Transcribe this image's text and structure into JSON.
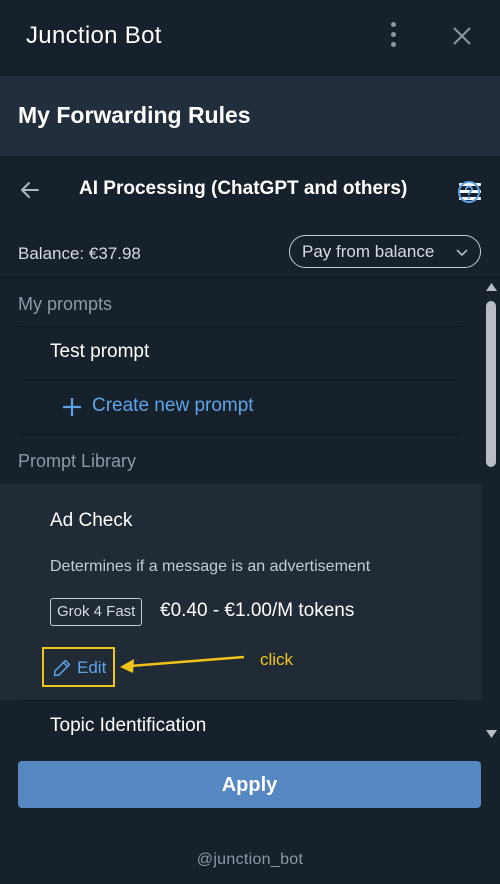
{
  "window": {
    "title": "Junction Bot",
    "menu_icon": "more-vertical-icon",
    "close_icon": "close-icon"
  },
  "header": {
    "title": "My Forwarding Rules",
    "menu_icon": "hamburger-icon"
  },
  "subheader": {
    "back_icon": "arrow-left-icon",
    "title": "AI Processing (ChatGPT and others)",
    "help_icon": "help-circle-icon"
  },
  "balance": {
    "text": "Balance: €37.98",
    "payment_select": {
      "selected": "Pay from balance",
      "icon": "chevron-down-icon"
    }
  },
  "my_prompts": {
    "label": "My prompts",
    "items": [
      {
        "label": "Test prompt"
      }
    ],
    "create_label": "Create new prompt",
    "create_icon": "plus-icon"
  },
  "library": {
    "label": "Prompt Library",
    "items": [
      {
        "title": "Ad Check",
        "description": "Determines if a message is an advertisement",
        "model": "Grok 4 Fast",
        "price": "€0.40 - €1.00/M tokens",
        "edit_label": "Edit",
        "edit_icon": "pencil-icon"
      },
      {
        "title": "Topic Identification"
      }
    ]
  },
  "annotation": {
    "text": "click",
    "color": "#f2c419"
  },
  "apply_label": "Apply",
  "footer": "@junction_bot",
  "colors": {
    "background": "#17212b",
    "header": "#232e3c",
    "card": "#202b36",
    "accent": "#5ea5e8",
    "button": "#5588c3"
  }
}
